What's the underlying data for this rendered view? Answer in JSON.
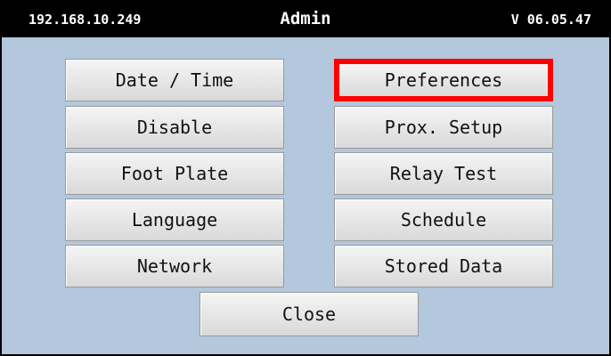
{
  "header": {
    "ip_address": "192.168.10.249",
    "title": "Admin",
    "version": "V 06.05.47"
  },
  "menu": {
    "left": [
      "Date / Time",
      "Disable",
      "Foot Plate",
      "Language",
      "Network"
    ],
    "right": [
      "Preferences",
      "Prox. Setup",
      "Relay Test",
      "Schedule",
      "Stored Data"
    ],
    "highlighted": "Preferences",
    "highlight_color": "#ff0000"
  },
  "close_label": "Close",
  "colors": {
    "background": "#b3c7dd",
    "titlebar": "#000000"
  }
}
